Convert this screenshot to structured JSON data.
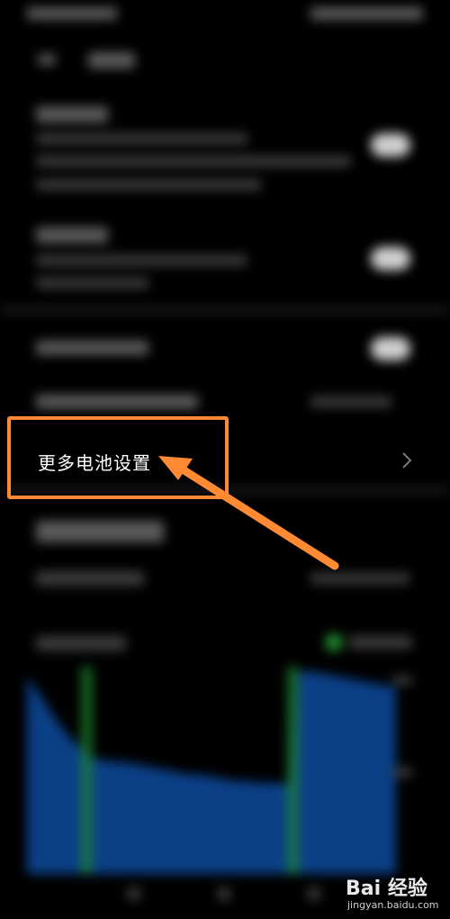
{
  "settings": {
    "more_battery_settings_label": "更多电池设置"
  },
  "battery_chart": {
    "level_percent": [
      95,
      88,
      80,
      72,
      66,
      60,
      56,
      55,
      54,
      54,
      53,
      52,
      51,
      50,
      49,
      48,
      48,
      47,
      46,
      45,
      45,
      44,
      44,
      44,
      43,
      97,
      98,
      97,
      96,
      95,
      94,
      93,
      92,
      91,
      90
    ],
    "charging_segments": [
      [
        5,
        6
      ],
      [
        24,
        25
      ]
    ]
  },
  "watermark": {
    "brand": "Bai 经验",
    "url": "jingyan.baidu.com"
  },
  "colors": {
    "background": "#000000",
    "highlight": "#ff8a33",
    "chart_fill": "#0b3f86",
    "charging": "#1f8a2e"
  }
}
